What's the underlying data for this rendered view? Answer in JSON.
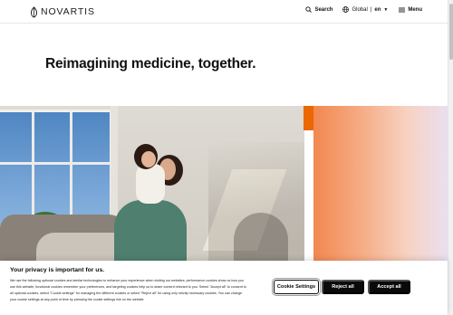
{
  "header": {
    "brand_name": "NOVARTIS",
    "search_label": "Search",
    "region_label": "Global",
    "language_label": "en",
    "menu_label": "Menu"
  },
  "hero": {
    "headline_prefix": "Reimagining medicine, ",
    "headline_emphasis": "together",
    "headline_suffix": "."
  },
  "cookie_banner": {
    "title": "Your privacy is important for us.",
    "body": "We use the following optional cookies and similar technologies to enhance your experience when visiting our websites: performance cookies show us how you use this website, functional cookies remember your preferences, and targeting cookies help us to share content relevant to you. Select \"Accept all\" to consent to all optional cookies, select \"Cookie settings\" for managing the different cookies or select \"Reject all\" for using only strictly necessary cookies. You can change your cookie settings at any point of time by pressing the cookie settings link on the website",
    "settings_label": "Cookie Settings",
    "reject_label": "Reject all",
    "accept_label": "Accept all"
  },
  "colors": {
    "brand_orange": "#ec6602",
    "button_dark": "#0a0a0a"
  },
  "icons": [
    "novartis-logo-icon",
    "search-icon",
    "globe-icon",
    "chevron-down-icon",
    "menu-icon"
  ]
}
